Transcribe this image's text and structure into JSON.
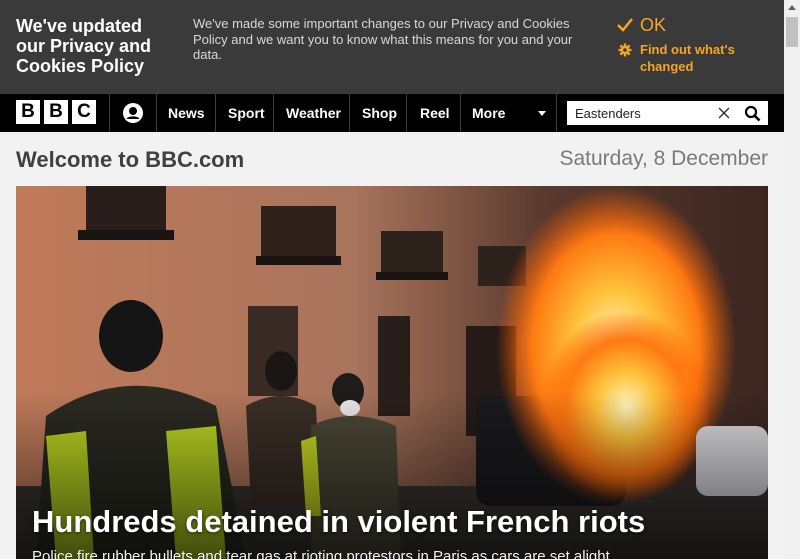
{
  "cookie_banner": {
    "title": "We've updated our Privacy and Cookies Policy",
    "text": "We've made some important changes to our Privacy and Cookies Policy and we want you to know what this means for you and your data.",
    "ok_label": "OK",
    "find_out_label": "Find out what's changed",
    "accent_color": "#f5a623"
  },
  "nav": {
    "logo_letters": [
      "B",
      "B",
      "C"
    ],
    "account_icon": "user-icon",
    "links": [
      "News",
      "Sport",
      "Weather",
      "Shop",
      "Reel",
      "More"
    ],
    "search_value": "Eastenders",
    "clear_icon": "close-icon",
    "search_icon": "search-icon"
  },
  "welcome": {
    "title": "Welcome to BBC.com",
    "date": "Saturday, 8 December"
  },
  "hero": {
    "headline": "Hundreds detained in violent French riots",
    "summary": "Police fire rubber bullets and tear gas at rioting protestors in Paris as cars are set alight."
  }
}
